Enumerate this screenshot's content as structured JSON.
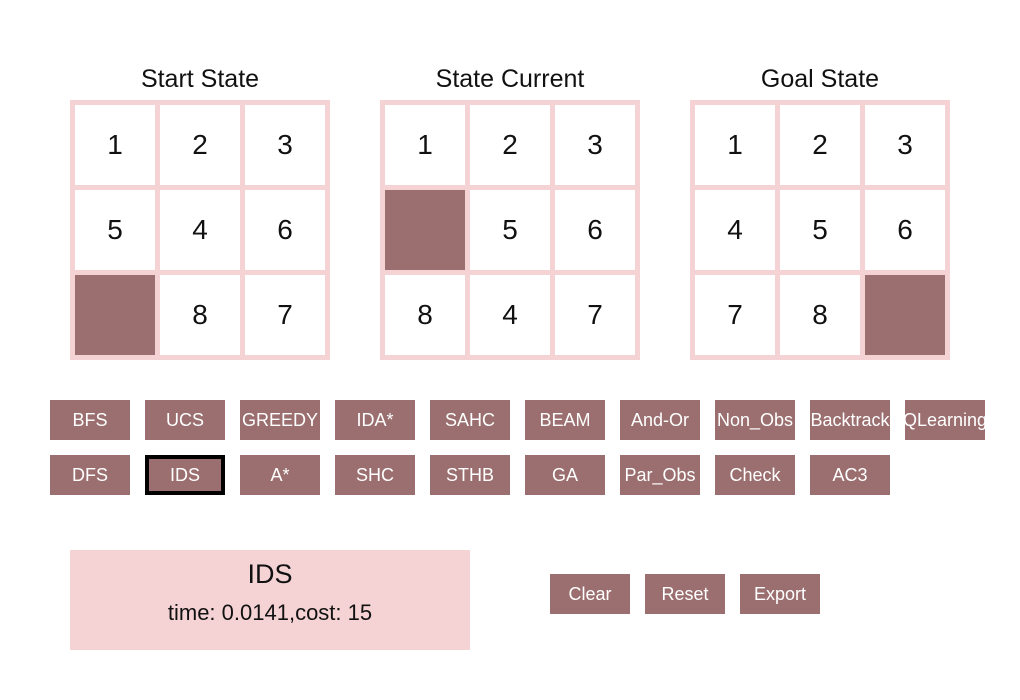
{
  "colors": {
    "tile_empty": "#9b6f6f",
    "board_border": "#f5d2d3",
    "button_bg": "#9b6f6f",
    "result_bg": "#f5d2d3"
  },
  "boards": {
    "start": {
      "title": "Start State",
      "tiles": [
        "1",
        "2",
        "3",
        "5",
        "4",
        "6",
        "",
        "8",
        "7"
      ]
    },
    "current": {
      "title": "State Current",
      "tiles": [
        "1",
        "2",
        "3",
        "",
        "5",
        "6",
        "8",
        "4",
        "7"
      ]
    },
    "goal": {
      "title": "Goal State",
      "tiles": [
        "1",
        "2",
        "3",
        "4",
        "5",
        "6",
        "7",
        "8",
        ""
      ]
    }
  },
  "algorithms": {
    "row1": [
      "BFS",
      "UCS",
      "GREEDY",
      "IDA*",
      "SAHC",
      "BEAM",
      "And-Or",
      "Non_Obs",
      "Backtrack",
      "QLearning"
    ],
    "row2": [
      "DFS",
      "IDS",
      "A*",
      "SHC",
      "STHB",
      "GA",
      "Par_Obs",
      "Check",
      "AC3"
    ],
    "selected": "IDS"
  },
  "result": {
    "title": "IDS",
    "info": "time: 0.0141,cost: 15"
  },
  "actions": {
    "clear": "Clear",
    "reset": "Reset",
    "export": "Export"
  }
}
